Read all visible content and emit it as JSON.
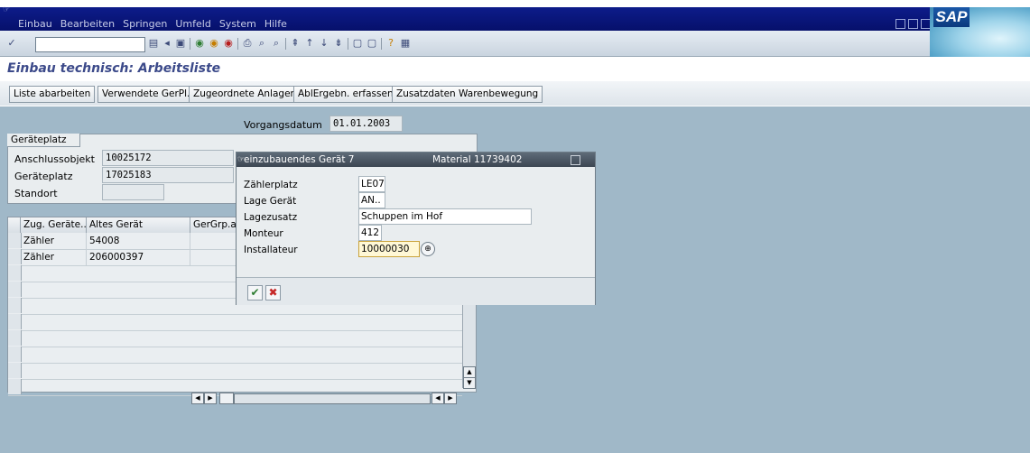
{
  "menu": [
    "Einbau",
    "Bearbeiten",
    "Springen",
    "Umfeld",
    "System",
    "Hilfe"
  ],
  "logo_text": "SAP",
  "page_title": "Einbau technisch: Arbeitsliste",
  "app_buttons": [
    "Liste abarbeiten",
    "Verwendete GerPl.",
    "Zugeordnete Anlagen",
    "AblErgebn. erfassen",
    "Zusatzdaten Warenbewegung"
  ],
  "vorgangsdatum": {
    "label": "Vorgangsdatum",
    "value": "01.01.2003"
  },
  "geraeteplatz": {
    "tab": "Geräteplatz",
    "fields": [
      {
        "label": "Anschlussobjekt",
        "value": "10025172"
      },
      {
        "label": "Geräteplatz",
        "value": "17025183"
      },
      {
        "label": "Standort",
        "value": ""
      }
    ]
  },
  "table": {
    "headers": [
      "Zug. Geräte...",
      "Altes Gerät",
      "GerGrp.a"
    ],
    "rows": [
      [
        "Zähler",
        "54008",
        ""
      ],
      [
        "Zähler",
        "206000397",
        ""
      ]
    ]
  },
  "popup": {
    "title": "einzubauendes Gerät 7",
    "material": "Material  11739402",
    "fields": [
      {
        "label": "Zählerplatz",
        "value": "LE07"
      },
      {
        "label": "Lage Gerät",
        "value": "AN.."
      },
      {
        "label": "Lagezusatz",
        "value": "Schuppen im Hof"
      },
      {
        "label": "Monteur",
        "value": "412"
      },
      {
        "label": "Installateur",
        "value": "10000030"
      }
    ]
  }
}
